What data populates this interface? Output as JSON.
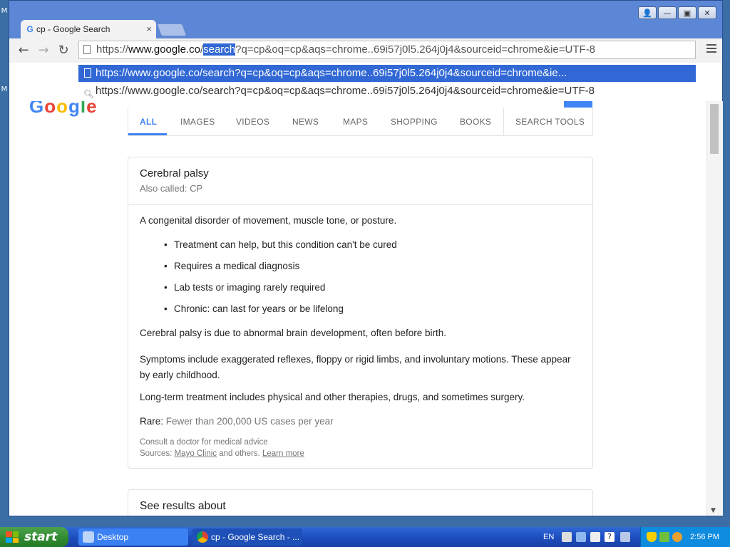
{
  "browser": {
    "tab_title": "cp - Google Search",
    "tab_close": "×",
    "url": {
      "prefix": "https://",
      "host": "www.google.co",
      "slash": "/",
      "selected": "search",
      "rest": "?q=cp&oq=cp&aqs=chrome..69i57j0l5.264j0j4&sourceid=chrome&ie=UTF-8"
    },
    "suggestions": [
      {
        "text": "https://www.google.co/search?q=cp&oq=cp&aqs=chrome..69i57j0l5.264j0j4&sourceid=chrome&ie...",
        "icon": "page-icon"
      },
      {
        "text": "https://www.google.co/search?q=cp&oq=cp&aqs=chrome..69i57j0l5.264j0j4&sourceid=chrome&ie=UTF-8",
        "icon": "search-icon"
      }
    ],
    "nav": {
      "back": "←",
      "forward": "→",
      "reload": "↻"
    }
  },
  "search_tabs": [
    "ALL",
    "IMAGES",
    "VIDEOS",
    "NEWS",
    "MAPS",
    "SHOPPING",
    "BOOKS",
    "SEARCH TOOLS"
  ],
  "knowledge_panel": {
    "title": "Cerebral palsy",
    "also_called": "Also called: CP",
    "summary": "A congenital disorder of movement, muscle tone, or posture.",
    "bullets": [
      "Treatment can help, but this condition can't be cured",
      "Requires a medical diagnosis",
      "Lab tests or imaging rarely required",
      "Chronic: can last for years or be lifelong"
    ],
    "para1": "Cerebral palsy is due to abnormal brain development, often before birth.",
    "para2": "Symptoms include exaggerated reflexes, floppy or rigid limbs, and involuntary motions. These appear by early childhood.",
    "para3": "Long-term treatment includes physical and other therapies, drugs, and sometimes surgery.",
    "rare_label": "Rare:",
    "rare_value": "Fewer than 200,000 US cases per year",
    "consult": "Consult a doctor for medical advice",
    "sources_label": "Sources:",
    "source_link": "Mayo Clinic",
    "and_others": "and others.",
    "learn_more": "Learn more"
  },
  "see_results": "See results about",
  "taskbar": {
    "start": "start",
    "tasks": [
      "Desktop",
      "cp - Google Search - ..."
    ],
    "language": "EN",
    "clock": "2:56 PM"
  },
  "colors": {
    "accent": "#4285f4",
    "selection": "#3168d5",
    "taskbar": "#1d4fc0",
    "start_green": "#2f8a2f"
  }
}
